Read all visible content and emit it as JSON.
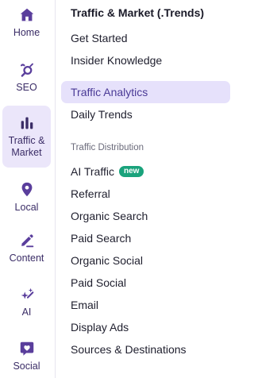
{
  "rail": {
    "items": [
      {
        "label": "Home",
        "icon": "home-icon",
        "active": false
      },
      {
        "label": "SEO",
        "icon": "seo-icon",
        "active": false
      },
      {
        "label": "Traffic &\nMarket",
        "icon": "bar-chart-icon",
        "active": true
      },
      {
        "label": "Local",
        "icon": "map-pin-icon",
        "active": false
      },
      {
        "label": "Content",
        "icon": "pencil-icon",
        "active": false
      },
      {
        "label": "AI",
        "icon": "sparkles-icon",
        "active": false
      },
      {
        "label": "Social",
        "icon": "heart-chat-icon",
        "active": false
      }
    ]
  },
  "panel": {
    "title": "Traffic & Market (.Trends)",
    "top_items": [
      {
        "label": "Get Started"
      },
      {
        "label": "Insider Knowledge"
      },
      {
        "label": "Traffic Analytics",
        "active": true
      },
      {
        "label": "Daily Trends"
      }
    ],
    "section_label": "Traffic Distribution",
    "distribution_items": [
      {
        "label": "AI Traffic",
        "badge": "new"
      },
      {
        "label": "Referral"
      },
      {
        "label": "Organic Search"
      },
      {
        "label": "Paid Search"
      },
      {
        "label": "Organic Social"
      },
      {
        "label": "Paid Social"
      },
      {
        "label": "Email"
      },
      {
        "label": "Display Ads"
      },
      {
        "label": "Sources & Destinations"
      }
    ]
  },
  "colors": {
    "accent": "#5a3e9c",
    "active_bg": "#e6e1fb",
    "badge_bg": "#1aa37c"
  }
}
